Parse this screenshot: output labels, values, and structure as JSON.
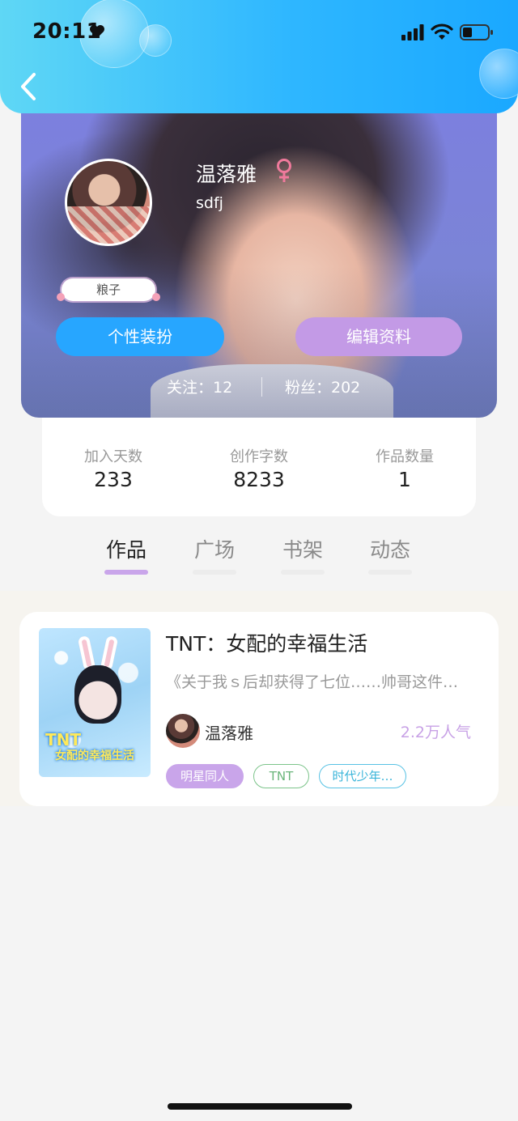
{
  "status_bar": {
    "time": "20:11"
  },
  "profile": {
    "name": "温落雅",
    "user_id": "sdfj",
    "tag": "粮子",
    "buttons": {
      "dress_up": "个性装扮",
      "edit_profile": "编辑资料"
    },
    "follow": "关注：12",
    "fans": "粉丝：202"
  },
  "stats": [
    {
      "label": "加入天数",
      "value": "233"
    },
    {
      "label": "创作字数",
      "value": "8233"
    },
    {
      "label": "作品数量",
      "value": "1"
    }
  ],
  "tabs": [
    {
      "label": "作品",
      "active": true
    },
    {
      "label": "广场",
      "active": false
    },
    {
      "label": "书架",
      "active": false
    },
    {
      "label": "动态",
      "active": false
    }
  ],
  "work": {
    "title": "TNT：女配的幸福生活",
    "summary": "《关于我ｓ后却获得了七位……帅哥这件…",
    "author": "温落雅",
    "popularity": "2.2万人气",
    "cover_text_top": "TNT",
    "cover_text_bottom": "女配的幸福生活",
    "tags": [
      "明星同人",
      "TNT",
      "时代少年…"
    ]
  },
  "colors": {
    "header_gradient_start": "#5fd7f5",
    "header_gradient_end": "#1aa8ff",
    "accent_blue": "#27a6ff",
    "accent_purple": "#c39ae6",
    "female_symbol": "#f07a9c"
  },
  "icons": [
    "heart-icon",
    "signal-icon",
    "wifi-icon",
    "battery-icon",
    "back-icon",
    "female-icon"
  ]
}
